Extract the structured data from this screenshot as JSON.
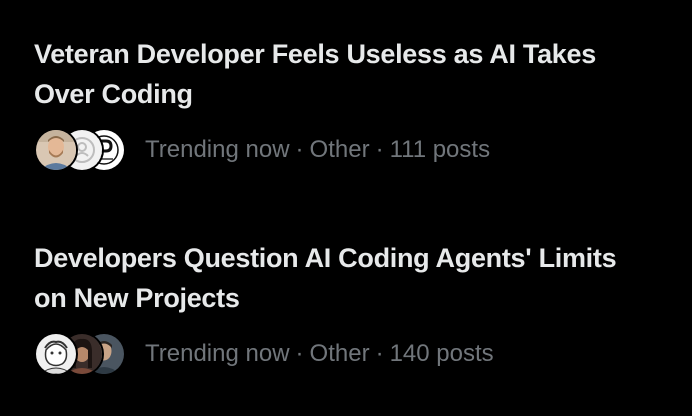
{
  "trends": [
    {
      "headline": "Veteran Developer Feels Useless as AI Takes Over Coding",
      "status": "Trending now",
      "category": "Other",
      "post_count": "111 posts",
      "separator": "·"
    },
    {
      "headline": "Developers Question AI Coding Agents' Limits on New Projects",
      "status": "Trending now",
      "category": "Other",
      "post_count": "140 posts",
      "separator": "·"
    }
  ],
  "colors": {
    "background": "#000000",
    "headline": "#e7e9ea",
    "meta": "#71767b"
  }
}
